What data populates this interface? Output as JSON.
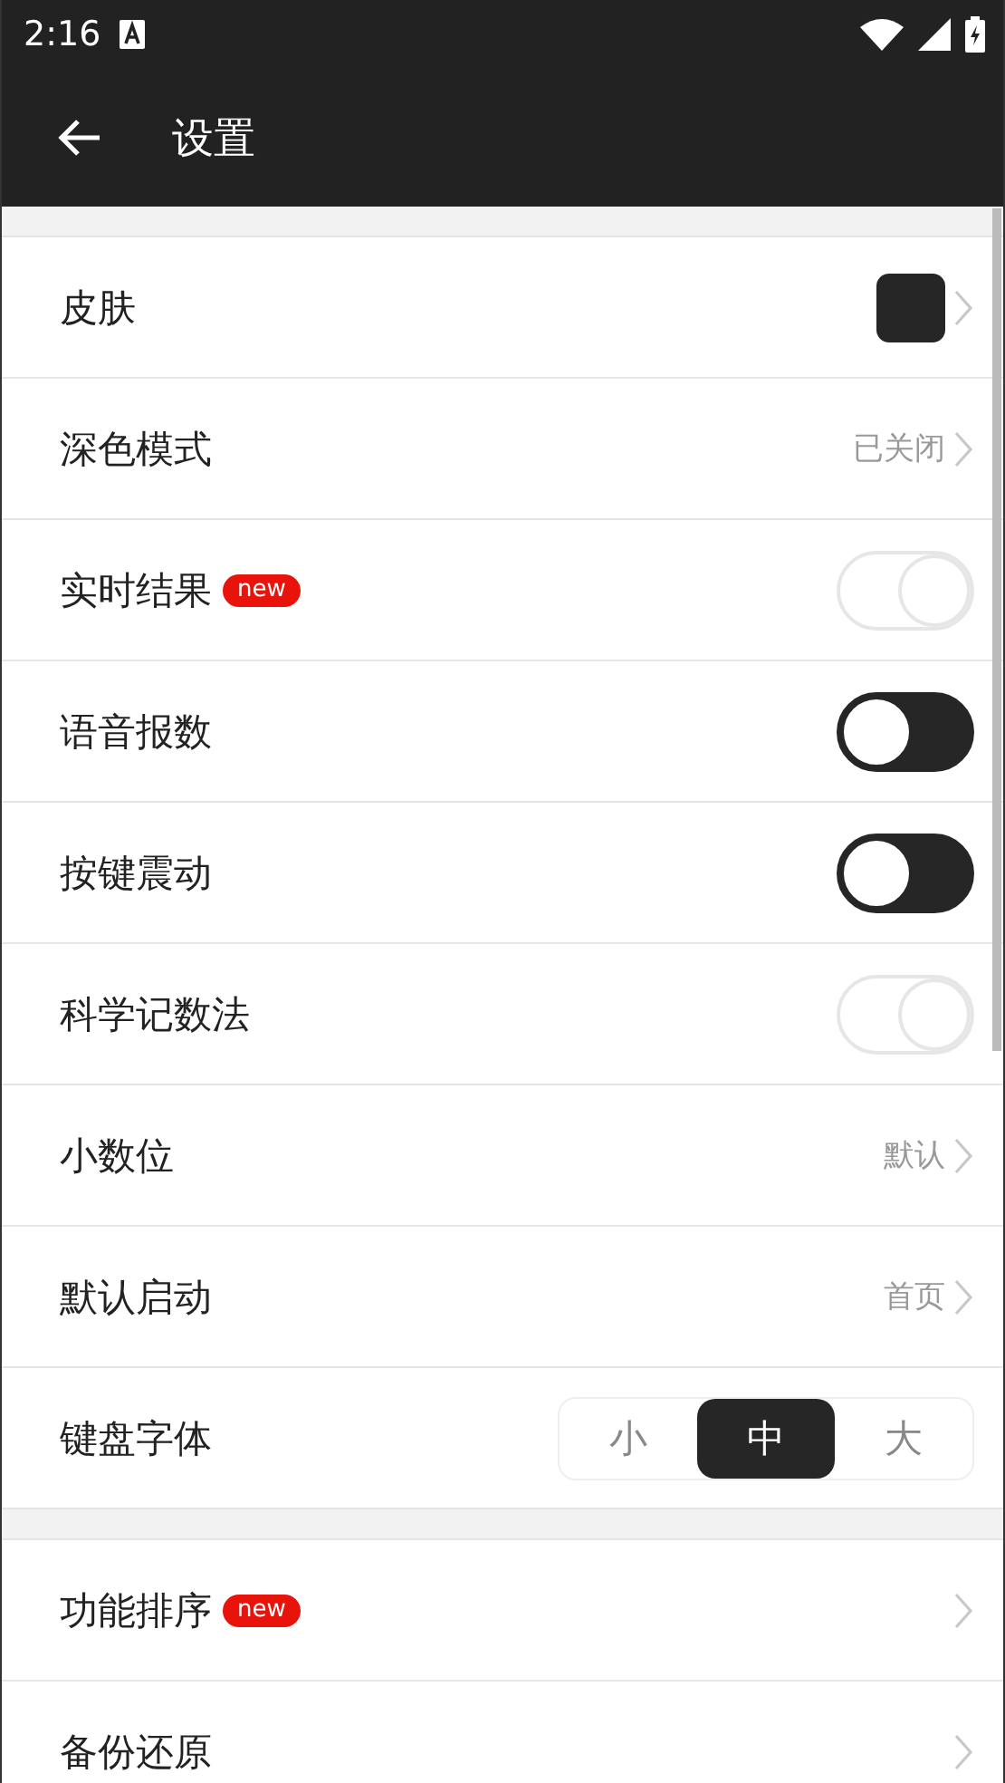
{
  "status_bar": {
    "time": "2:16"
  },
  "toolbar": {
    "title": "设置"
  },
  "sections": [
    {
      "items": [
        {
          "kind": "swatch",
          "label": "皮肤",
          "color": "#262626"
        },
        {
          "kind": "value",
          "label": "深色模式",
          "value": "已关闭"
        },
        {
          "kind": "toggle",
          "label": "实时结果",
          "badge": "new",
          "on": false
        },
        {
          "kind": "toggle",
          "label": "语音报数",
          "on": true
        },
        {
          "kind": "toggle",
          "label": "按键震动",
          "on": true
        },
        {
          "kind": "toggle",
          "label": "科学记数法",
          "on": false
        },
        {
          "kind": "value",
          "label": "小数位",
          "value": "默认"
        },
        {
          "kind": "value",
          "label": "默认启动",
          "value": "首页"
        },
        {
          "kind": "segmented",
          "label": "键盘字体",
          "options": [
            {
              "label": "小",
              "selected": false
            },
            {
              "label": "中",
              "selected": true
            },
            {
              "label": "大",
              "selected": false
            }
          ]
        }
      ]
    },
    {
      "items": [
        {
          "kind": "value",
          "label": "功能排序",
          "badge": "new"
        },
        {
          "kind": "value",
          "label": "备份还原"
        }
      ]
    }
  ]
}
